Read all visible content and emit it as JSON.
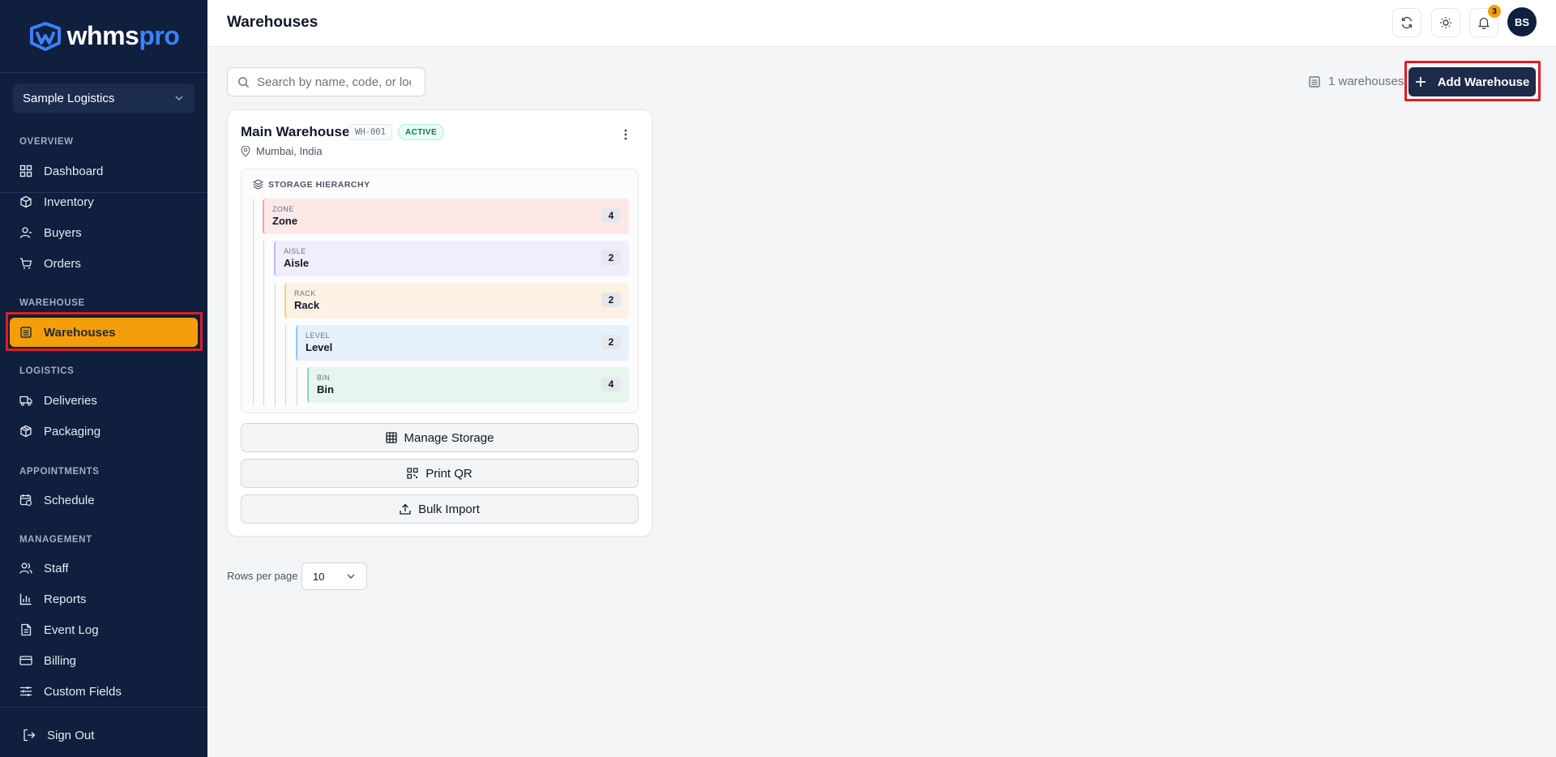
{
  "brand": {
    "name_part1": "whms",
    "name_part2": "pro",
    "accent": "#3b82f6"
  },
  "org_selector": {
    "value": "Sample Logistics"
  },
  "sidebar": {
    "sections": {
      "overview": "OVERVIEW",
      "warehouse": "WAREHOUSE",
      "logistics": "LOGISTICS",
      "appointments": "APPOINTMENTS",
      "management": "MANAGEMENT"
    },
    "items": {
      "dashboard": "Dashboard",
      "inventory": "Inventory",
      "buyers": "Buyers",
      "orders": "Orders",
      "warehouses": "Warehouses",
      "deliveries": "Deliveries",
      "packaging": "Packaging",
      "schedule": "Schedule",
      "staff": "Staff",
      "reports": "Reports",
      "event_log": "Event Log",
      "billing": "Billing",
      "custom_fields": "Custom Fields"
    },
    "active_item": "warehouses",
    "active_color": "#f59e0b",
    "sign_out": "Sign Out"
  },
  "header": {
    "title": "Warehouses",
    "notification_count": "3",
    "avatar_initials": "BS"
  },
  "toolbar": {
    "search_placeholder": "Search by name, code, or location",
    "warehouse_count": "1 warehouses",
    "add_button": "Add Warehouse"
  },
  "warehouse_card": {
    "name": "Main Warehouse",
    "code": "WH-001",
    "status": "ACTIVE",
    "location": "Mumbai, India",
    "hierarchy_title": "STORAGE HIERARCHY",
    "levels": [
      {
        "label": "ZONE",
        "name": "Zone",
        "count": "4",
        "color": "#fde8e8"
      },
      {
        "label": "AISLE",
        "name": "Aisle",
        "count": "2",
        "color": "#f1edfd"
      },
      {
        "label": "RACK",
        "name": "Rack",
        "count": "2",
        "color": "#fdf1e4"
      },
      {
        "label": "LEVEL",
        "name": "Level",
        "count": "2",
        "color": "#e6f1fc"
      },
      {
        "label": "BIN",
        "name": "Bin",
        "count": "4",
        "color": "#e6f5ee"
      }
    ],
    "actions": {
      "manage_storage": "Manage Storage",
      "print_qr": "Print QR",
      "bulk_import": "Bulk Import"
    }
  },
  "pagination": {
    "rows_per_page_label": "Rows per page",
    "rows_per_page_value": "10"
  }
}
